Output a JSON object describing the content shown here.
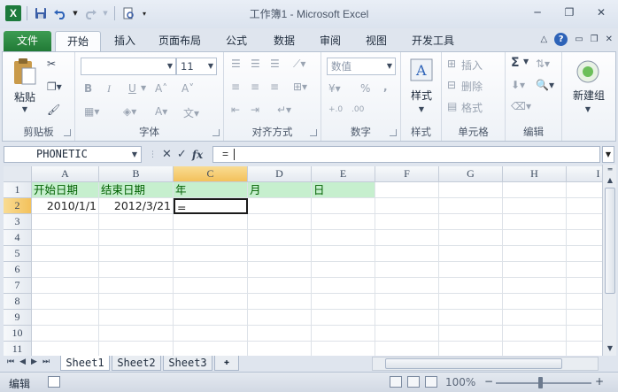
{
  "window": {
    "title": "工作簿1 - Microsoft Excel"
  },
  "ribbon_tabs": [
    "文件",
    "开始",
    "插入",
    "页面布局",
    "公式",
    "数据",
    "审阅",
    "视图",
    "开发工具"
  ],
  "ribbon": {
    "clipboard": {
      "paste": "粘贴",
      "label": "剪贴板"
    },
    "font": {
      "name_placeholder": "",
      "size": "11",
      "bold": "B",
      "italic": "I",
      "underline": "U",
      "label": "字体"
    },
    "alignment": {
      "label": "对齐方式"
    },
    "number": {
      "format": "数值",
      "percent": "%",
      "comma": ",",
      "label": "数字"
    },
    "styles": {
      "label": "样式"
    },
    "cells": {
      "insert": "插入",
      "delete": "删除",
      "format": "格式",
      "label": "单元格"
    },
    "editing": {
      "sum": "Σ",
      "label": "编辑"
    },
    "newgroup": {
      "label": "新建组"
    }
  },
  "formula_bar": {
    "name_box": "PHONETIC",
    "cancel": "✕",
    "enter": "✓",
    "fx": "fx",
    "content": "="
  },
  "columns": [
    "A",
    "B",
    "C",
    "D",
    "E",
    "F",
    "G",
    "H",
    "I"
  ],
  "rows": [
    "1",
    "2",
    "3",
    "4",
    "5",
    "6",
    "7",
    "8",
    "9",
    "10",
    "11"
  ],
  "cells": {
    "A1": "开始日期",
    "B1": "结束日期",
    "C1": "年",
    "D1": "月",
    "E1": "日",
    "A2": "2010/1/1",
    "B2": "2012/3/21",
    "C2": "="
  },
  "sheet_tabs": [
    "Sheet1",
    "Sheet2",
    "Sheet3"
  ],
  "status": {
    "mode": "编辑",
    "zoom": "100%"
  },
  "colors": {
    "header_fill": "#c6efce",
    "header_text": "#006100",
    "file_tab": "#217a36"
  }
}
